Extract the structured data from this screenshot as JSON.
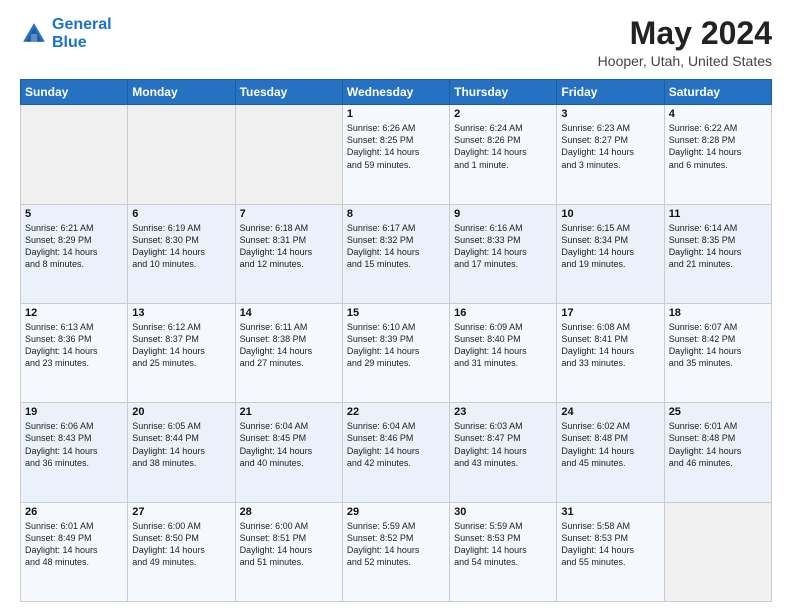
{
  "header": {
    "logo_line1": "General",
    "logo_line2": "Blue",
    "month_year": "May 2024",
    "location": "Hooper, Utah, United States"
  },
  "days_of_week": [
    "Sunday",
    "Monday",
    "Tuesday",
    "Wednesday",
    "Thursday",
    "Friday",
    "Saturday"
  ],
  "weeks": [
    [
      {
        "day": "",
        "info": ""
      },
      {
        "day": "",
        "info": ""
      },
      {
        "day": "",
        "info": ""
      },
      {
        "day": "1",
        "info": "Sunrise: 6:26 AM\nSunset: 8:25 PM\nDaylight: 14 hours\nand 59 minutes."
      },
      {
        "day": "2",
        "info": "Sunrise: 6:24 AM\nSunset: 8:26 PM\nDaylight: 14 hours\nand 1 minute."
      },
      {
        "day": "3",
        "info": "Sunrise: 6:23 AM\nSunset: 8:27 PM\nDaylight: 14 hours\nand 3 minutes."
      },
      {
        "day": "4",
        "info": "Sunrise: 6:22 AM\nSunset: 8:28 PM\nDaylight: 14 hours\nand 6 minutes."
      }
    ],
    [
      {
        "day": "5",
        "info": "Sunrise: 6:21 AM\nSunset: 8:29 PM\nDaylight: 14 hours\nand 8 minutes."
      },
      {
        "day": "6",
        "info": "Sunrise: 6:19 AM\nSunset: 8:30 PM\nDaylight: 14 hours\nand 10 minutes."
      },
      {
        "day": "7",
        "info": "Sunrise: 6:18 AM\nSunset: 8:31 PM\nDaylight: 14 hours\nand 12 minutes."
      },
      {
        "day": "8",
        "info": "Sunrise: 6:17 AM\nSunset: 8:32 PM\nDaylight: 14 hours\nand 15 minutes."
      },
      {
        "day": "9",
        "info": "Sunrise: 6:16 AM\nSunset: 8:33 PM\nDaylight: 14 hours\nand 17 minutes."
      },
      {
        "day": "10",
        "info": "Sunrise: 6:15 AM\nSunset: 8:34 PM\nDaylight: 14 hours\nand 19 minutes."
      },
      {
        "day": "11",
        "info": "Sunrise: 6:14 AM\nSunset: 8:35 PM\nDaylight: 14 hours\nand 21 minutes."
      }
    ],
    [
      {
        "day": "12",
        "info": "Sunrise: 6:13 AM\nSunset: 8:36 PM\nDaylight: 14 hours\nand 23 minutes."
      },
      {
        "day": "13",
        "info": "Sunrise: 6:12 AM\nSunset: 8:37 PM\nDaylight: 14 hours\nand 25 minutes."
      },
      {
        "day": "14",
        "info": "Sunrise: 6:11 AM\nSunset: 8:38 PM\nDaylight: 14 hours\nand 27 minutes."
      },
      {
        "day": "15",
        "info": "Sunrise: 6:10 AM\nSunset: 8:39 PM\nDaylight: 14 hours\nand 29 minutes."
      },
      {
        "day": "16",
        "info": "Sunrise: 6:09 AM\nSunset: 8:40 PM\nDaylight: 14 hours\nand 31 minutes."
      },
      {
        "day": "17",
        "info": "Sunrise: 6:08 AM\nSunset: 8:41 PM\nDaylight: 14 hours\nand 33 minutes."
      },
      {
        "day": "18",
        "info": "Sunrise: 6:07 AM\nSunset: 8:42 PM\nDaylight: 14 hours\nand 35 minutes."
      }
    ],
    [
      {
        "day": "19",
        "info": "Sunrise: 6:06 AM\nSunset: 8:43 PM\nDaylight: 14 hours\nand 36 minutes."
      },
      {
        "day": "20",
        "info": "Sunrise: 6:05 AM\nSunset: 8:44 PM\nDaylight: 14 hours\nand 38 minutes."
      },
      {
        "day": "21",
        "info": "Sunrise: 6:04 AM\nSunset: 8:45 PM\nDaylight: 14 hours\nand 40 minutes."
      },
      {
        "day": "22",
        "info": "Sunrise: 6:04 AM\nSunset: 8:46 PM\nDaylight: 14 hours\nand 42 minutes."
      },
      {
        "day": "23",
        "info": "Sunrise: 6:03 AM\nSunset: 8:47 PM\nDaylight: 14 hours\nand 43 minutes."
      },
      {
        "day": "24",
        "info": "Sunrise: 6:02 AM\nSunset: 8:48 PM\nDaylight: 14 hours\nand 45 minutes."
      },
      {
        "day": "25",
        "info": "Sunrise: 6:01 AM\nSunset: 8:48 PM\nDaylight: 14 hours\nand 46 minutes."
      }
    ],
    [
      {
        "day": "26",
        "info": "Sunrise: 6:01 AM\nSunset: 8:49 PM\nDaylight: 14 hours\nand 48 minutes."
      },
      {
        "day": "27",
        "info": "Sunrise: 6:00 AM\nSunset: 8:50 PM\nDaylight: 14 hours\nand 49 minutes."
      },
      {
        "day": "28",
        "info": "Sunrise: 6:00 AM\nSunset: 8:51 PM\nDaylight: 14 hours\nand 51 minutes."
      },
      {
        "day": "29",
        "info": "Sunrise: 5:59 AM\nSunset: 8:52 PM\nDaylight: 14 hours\nand 52 minutes."
      },
      {
        "day": "30",
        "info": "Sunrise: 5:59 AM\nSunset: 8:53 PM\nDaylight: 14 hours\nand 54 minutes."
      },
      {
        "day": "31",
        "info": "Sunrise: 5:58 AM\nSunset: 8:53 PM\nDaylight: 14 hours\nand 55 minutes."
      },
      {
        "day": "",
        "info": ""
      }
    ]
  ]
}
